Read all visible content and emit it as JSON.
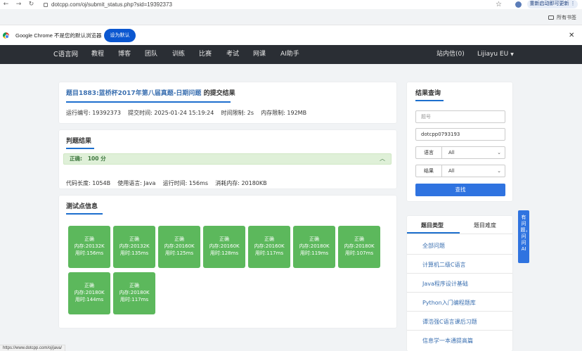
{
  "browser": {
    "url": "dotcpp.com/oj/submit_status.php?sid=19392373",
    "update_label": "重新启动即可更新",
    "bookmarks_label": "所有书签",
    "default_browser_message": "Google Chrome 不是您的默认浏览器",
    "set_default_label": "设为默认",
    "status_url": "https://www.dotcpp.com/oj/java/"
  },
  "nav": {
    "brand": "C语言网",
    "items": [
      "教程",
      "博客",
      "团队",
      "训练",
      "比赛",
      "考试",
      "网课",
      "AI助手"
    ],
    "messages": "站内信(0)",
    "user": "Lijiayu EU"
  },
  "submission": {
    "problem_link": "题目1883:蓝桥杯2017年第八届真题-日期问题",
    "title_suffix": "的提交结果",
    "meta": "运行编号: 19392373    提交时间: 2025-01-24 15:19:24    时间限制: 2s    内存限制: 192MB"
  },
  "judge": {
    "title": "判题结果",
    "result": "正确:   100 分",
    "stats": "代码长度: 1054B    使用语言: Java    运行时间: 156ms    消耗内存: 20180KB"
  },
  "tests": {
    "title": "测试点信息",
    "items": [
      {
        "status": "正确",
        "memory": "内存:20132K",
        "time": "用时:156ms"
      },
      {
        "status": "正确",
        "memory": "内存:20132K",
        "time": "用时:135ms"
      },
      {
        "status": "正确",
        "memory": "内存:20160K",
        "time": "用时:125ms"
      },
      {
        "status": "正确",
        "memory": "内存:20160K",
        "time": "用时:128ms"
      },
      {
        "status": "正确",
        "memory": "内存:20160K",
        "time": "用时:117ms"
      },
      {
        "status": "正确",
        "memory": "内存:20180K",
        "time": "用时:119ms"
      },
      {
        "status": "正确",
        "memory": "内存:20180K",
        "time": "用时:107ms"
      },
      {
        "status": "正确",
        "memory": "内存:20180K",
        "time": "用时:144ms"
      },
      {
        "status": "正确",
        "memory": "内存:20180K",
        "time": "用时:117ms"
      }
    ]
  },
  "query": {
    "title": "结果查询",
    "problem_placeholder": "题号",
    "user_value": "dotcpp0793193",
    "language_label": "语言",
    "language_value": "All",
    "result_label": "结果",
    "result_value": "All",
    "search_label": "查找"
  },
  "categories": {
    "tab_type": "题目类型",
    "tab_difficulty": "题目难度",
    "items": [
      "全部问题",
      "计算机二级C语言",
      "Java程序设计基础",
      "Python入门编程题库",
      "谭浩强C语言课后习题",
      "信息学一本通提高篇"
    ]
  },
  "ai_float": {
    "label": "有问题，问问AI"
  }
}
